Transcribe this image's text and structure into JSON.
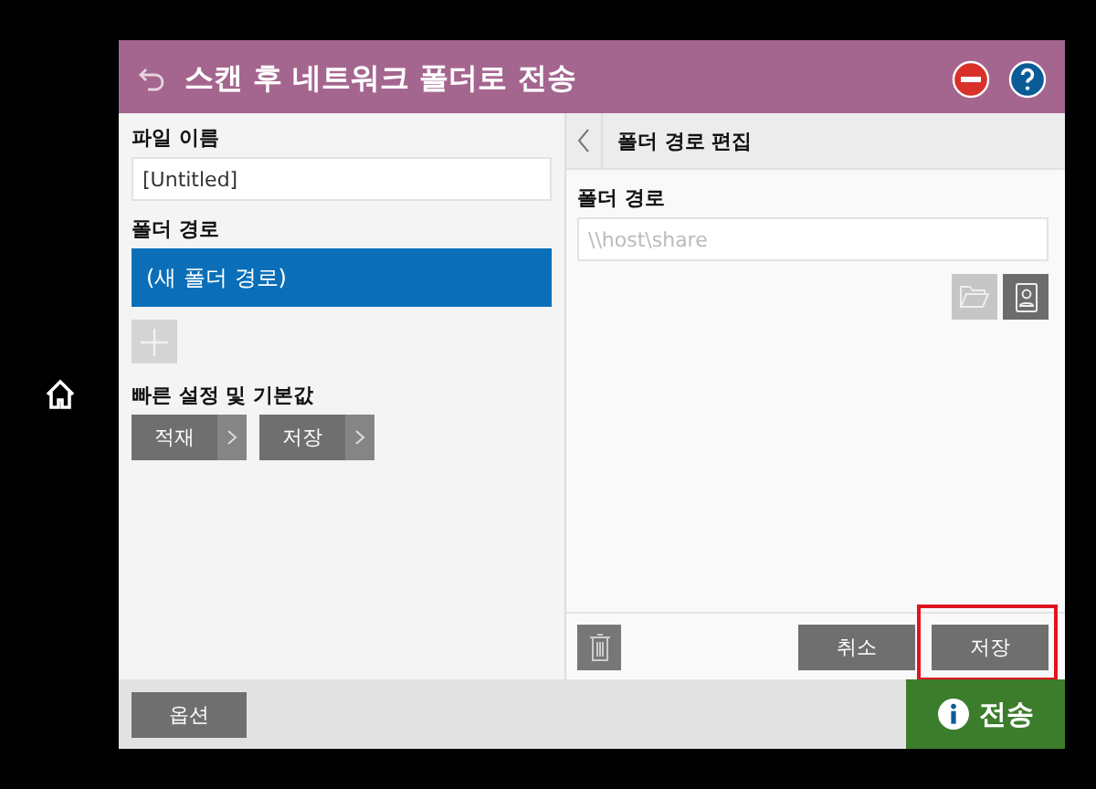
{
  "title": "스캔 후 네트워크 폴더로 전송",
  "left_panel": {
    "file_name": {
      "label": "파일 이름",
      "value": "[Untitled]"
    },
    "folder_paths": {
      "label": "폴더 경로",
      "items": [
        {
          "label": "(새 폴더 경로)",
          "selected": true
        }
      ],
      "add_disabled": true
    },
    "quick_sets": {
      "label": "빠른 설정 및 기본값",
      "buttons": [
        "적재",
        "저장"
      ]
    }
  },
  "right_panel": {
    "header": "폴더 경로 편집",
    "folder_path": {
      "label": "폴더 경로",
      "placeholder": "\\\\host\\share"
    },
    "browse_disabled": true,
    "buttons": [
      {
        "label": "취소",
        "highlighted": false
      },
      {
        "label": "저장",
        "highlighted": true
      }
    ]
  },
  "bottom_bar": {
    "options": "옵션",
    "send": "전송"
  }
}
